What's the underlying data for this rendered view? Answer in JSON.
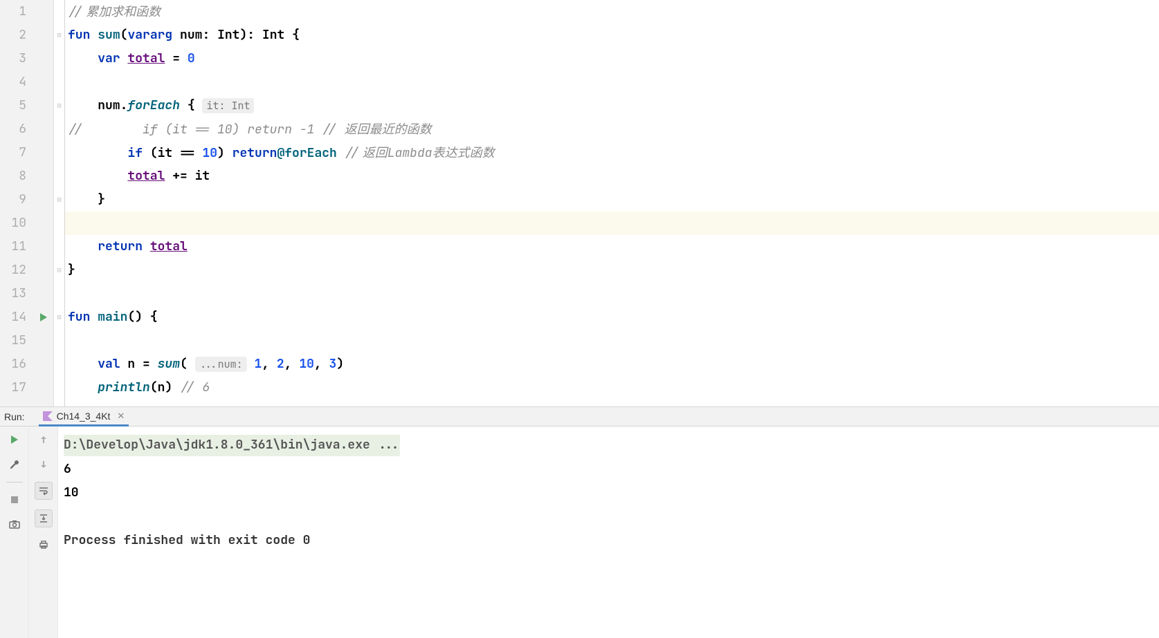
{
  "gutter": {
    "lines": [
      "1",
      "2",
      "3",
      "4",
      "5",
      "6",
      "7",
      "8",
      "9",
      "10",
      "11",
      "12",
      "13",
      "14",
      "15",
      "16",
      "17"
    ]
  },
  "code": {
    "l1": {
      "slashes": "//",
      "comment": " 累加求和函数"
    },
    "l2": {
      "kw_fun": "fun",
      "fn": "sum",
      "lp": "(",
      "kw_vararg": "vararg",
      "param": " num: ",
      "type": "Int",
      "rp": ")",
      "colon": ": ",
      "ret": "Int",
      "brace": " {"
    },
    "l3": {
      "kw_var": "var",
      "sp": " ",
      "name": "total",
      "eq": " = ",
      "zero": "0"
    },
    "l4": "",
    "l5": {
      "indent": "    ",
      "obj": "num.",
      "fn": "forEach",
      "brace": " {",
      "hint": "it: Int"
    },
    "l6": {
      "slashes": "//",
      "code_comment": "        if (it == 10) return -1 // ",
      "comment_cn": "返回最近的函数"
    },
    "l7": {
      "indent": "        ",
      "kw_if": "if",
      "cond": " (it == ",
      "ten": "10",
      "rp": ") ",
      "kw_return": "return",
      "label": "@forEach",
      "sp": " ",
      "slashes": "//",
      "comment_pre": " 返回",
      "comment_en": "Lambda",
      "comment_post": "表达式函数"
    },
    "l8": {
      "indent": "        ",
      "name": "total",
      "op": " += it"
    },
    "l9": {
      "indent": "    ",
      "brace": "}"
    },
    "l10": "",
    "l11": {
      "indent": "    ",
      "kw_return": "return",
      "sp": " ",
      "name": "total"
    },
    "l12": {
      "brace": "}"
    },
    "l13": "",
    "l14": {
      "kw_fun": "fun",
      "fn": " main",
      "paren": "() {"
    },
    "l15": "",
    "l16": {
      "indent": "    ",
      "kw_val": "val",
      "decl": " n = ",
      "fn": "sum",
      "lp": "(",
      "hint": "...num:",
      "sp": " ",
      "n1": "1",
      "c1": ", ",
      "n2": "2",
      "c2": ", ",
      "n3": "10",
      "c3": ", ",
      "n4": "3",
      "rp": ")"
    },
    "l17": {
      "indent": "    ",
      "fn": "println",
      "lp": "(",
      "arg": "n",
      "rp": ") ",
      "comment": "// 6"
    }
  },
  "run": {
    "label": "Run:",
    "tab": "Ch14_3_4Kt",
    "cmd": "D:\\Develop\\Java\\jdk1.8.0_361\\bin\\java.exe ...",
    "out1": "6",
    "out2": "10",
    "exit": "Process finished with exit code 0"
  }
}
